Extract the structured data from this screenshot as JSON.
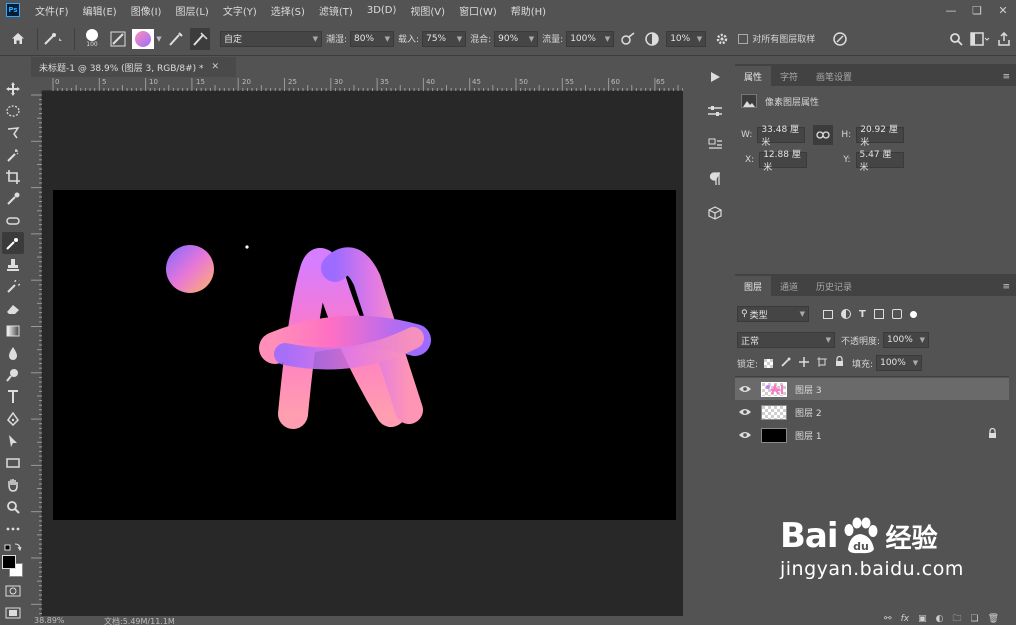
{
  "app": {
    "logo": "Ps"
  },
  "menu": [
    "文件(F)",
    "编辑(E)",
    "图像(I)",
    "图层(L)",
    "文字(Y)",
    "选择(S)",
    "滤镜(T)",
    "3D(D)",
    "视图(V)",
    "窗口(W)",
    "帮助(H)"
  ],
  "options_bar": {
    "brush_size": "100",
    "preset": "自定",
    "wet_label": "潮湿:",
    "wet_value": "80%",
    "load_label": "载入:",
    "load_value": "75%",
    "mix_label": "混合:",
    "mix_value": "90%",
    "flow_label": "流量:",
    "flow_value": "100%",
    "angle_value": "10%",
    "sample_all_label": "对所有图层取样"
  },
  "document": {
    "tab_title": "未标题-1 @ 38.9% (图层 3, RGB/8#) *",
    "ruler_numbers": [
      "0",
      "5",
      "10",
      "15",
      "20",
      "25",
      "30",
      "35",
      "40",
      "45",
      "50",
      "55",
      "60",
      "65"
    ],
    "zoom": "38.89%",
    "doc_info": "文档:5.49M/11.1M",
    "artwork_text": "AI"
  },
  "properties_panel": {
    "tabs": [
      "属性",
      "字符",
      "画笔设置"
    ],
    "title": "像素图层属性",
    "w_label": "W:",
    "w_value": "33.48 厘米",
    "h_label": "H:",
    "h_value": "20.92 厘米",
    "x_label": "X:",
    "x_value": "12.88 厘米",
    "y_label": "Y:",
    "y_value": "5.47 厘米"
  },
  "layers_panel": {
    "tabs": [
      "图层",
      "通道",
      "历史记录"
    ],
    "filter_kind": "类型",
    "blend_mode": "正常",
    "opacity_label": "不透明度:",
    "opacity_value": "100%",
    "lock_label": "锁定:",
    "fill_label": "填充:",
    "fill_value": "100%",
    "layers": [
      {
        "name": "图层 3"
      },
      {
        "name": "图层 2"
      },
      {
        "name": "图层 1"
      }
    ],
    "bottom_icons": [
      "link-icon",
      "fx-icon",
      "mask-icon",
      "adjustment-icon",
      "group-icon",
      "new-layer-icon",
      "trash-icon"
    ],
    "fx_label": "fx"
  },
  "watermark": {
    "brand_left": "Bai",
    "brand_right": "经验",
    "url": "jingyan.baidu.com"
  },
  "colors": {
    "ui_bg": "#535353",
    "pasteboard": "#282828",
    "canvas": "#000000",
    "gradient_start": "#ff8fb8",
    "gradient_end": "#9b6dff"
  }
}
